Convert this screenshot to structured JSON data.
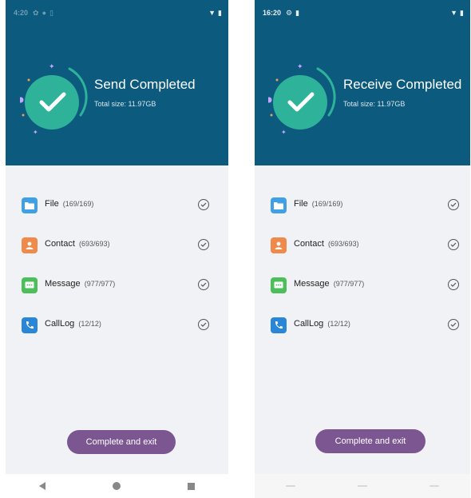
{
  "left": {
    "status": {
      "time": "4:20"
    },
    "title": "Send Completed",
    "subtitle": "Total size: 11.97GB",
    "button": "Complete and exit",
    "items": [
      {
        "label": "File",
        "count": "(169/169)",
        "icon": "folder-icon",
        "color": "#3fa0e6"
      },
      {
        "label": "Contact",
        "count": "(693/693)",
        "icon": "contact-icon",
        "color": "#f08a4b"
      },
      {
        "label": "Message",
        "count": "(977/977)",
        "icon": "message-icon",
        "color": "#4cbf5a"
      },
      {
        "label": "CallLog",
        "count": "(12/12)",
        "icon": "phone-icon",
        "color": "#2a86d6"
      }
    ]
  },
  "right": {
    "status": {
      "time": "16:20"
    },
    "title": "Receive Completed",
    "subtitle": "Total size: 11.97GB",
    "button": "Complete and exit",
    "items": [
      {
        "label": "File",
        "count": "(169/169)",
        "icon": "folder-icon",
        "color": "#3fa0e6"
      },
      {
        "label": "Contact",
        "count": "(693/693)",
        "icon": "contact-icon",
        "color": "#f08a4b"
      },
      {
        "label": "Message",
        "count": "(977/977)",
        "icon": "message-icon",
        "color": "#4cbf5a"
      },
      {
        "label": "CallLog",
        "count": "(12/12)",
        "icon": "phone-icon",
        "color": "#2a86d6"
      }
    ]
  },
  "colors": {
    "header": "#0c5a7d",
    "badge": "#2eb39a",
    "button": "#7b5691",
    "background": "#f1f2f6"
  }
}
